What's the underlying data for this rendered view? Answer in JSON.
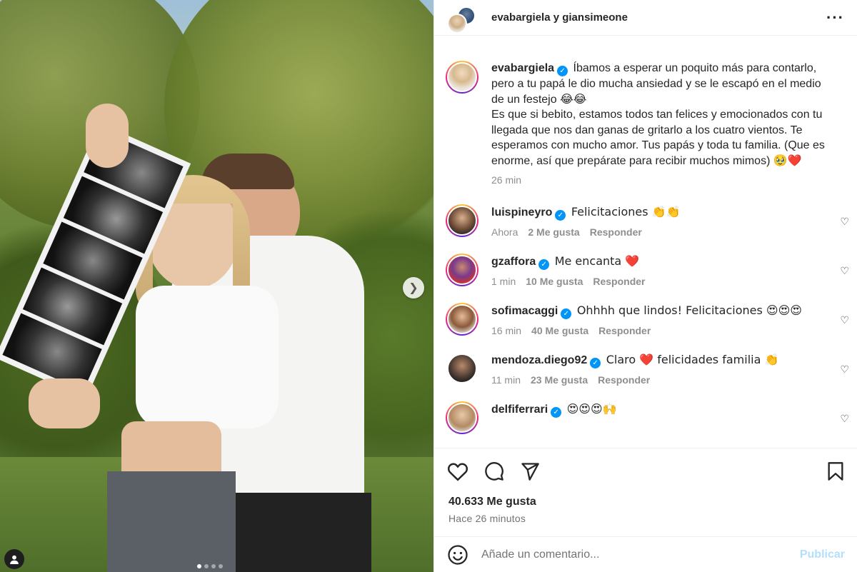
{
  "header": {
    "title": "evabargiela y giansimeone"
  },
  "caption": {
    "username": "evabargiela",
    "text": "Íbamos a esperar un poquito más para contarlo, pero a tu papá le dio mucha ansiedad y se le escapó en el medio de un festejo 😂😂",
    "text2": "Es que si bebito, estamos todos tan felices y emocionados con tu llegada que nos dan ganas de gritarlo a los cuatro vientos. Te esperamos con mucho amor. Tus papás y toda tu familia. (Que es enorme, así que prepárate para recibir muchos mimos) 🥹❤️",
    "time": "26 min"
  },
  "comments": [
    {
      "username": "luispineyro",
      "text": "Felicitaciones 👏👏",
      "time": "Ahora",
      "likes": "2 Me gusta",
      "reply": "Responder"
    },
    {
      "username": "gzaffora",
      "text": "Me encanta ❤️",
      "time": "1 min",
      "likes": "10 Me gusta",
      "reply": "Responder"
    },
    {
      "username": "sofimacaggi",
      "text": "Ohhhh que lindos! Felicitaciones 😍😍😍",
      "time": "16 min",
      "likes": "40 Me gusta",
      "reply": "Responder"
    },
    {
      "username": "mendoza.diego92",
      "text": "Claro ❤️ felicidades familia 👏",
      "time": "11 min",
      "likes": "23 Me gusta",
      "reply": "Responder"
    },
    {
      "username": "delfiferrari",
      "text": "😍😍😍🙌",
      "time": "",
      "likes": "",
      "reply": ""
    }
  ],
  "stats": {
    "likes": "40.633 Me gusta",
    "ago": "Hace 26 minutos"
  },
  "add_comment": {
    "placeholder": "Añade un comentario...",
    "publish": "Publicar"
  },
  "colors": {
    "verified": "#0095f6",
    "publish_disabled": "#b2dffc",
    "text": "#262626",
    "muted": "#8e8e8e"
  },
  "icons": [
    "chevron-right-icon",
    "user-tag-icon",
    "more-icon",
    "verified-icon",
    "heart-icon",
    "comment-icon",
    "share-icon",
    "bookmark-icon",
    "emoji-icon"
  ],
  "carousel": {
    "total": 4,
    "active": 1
  }
}
